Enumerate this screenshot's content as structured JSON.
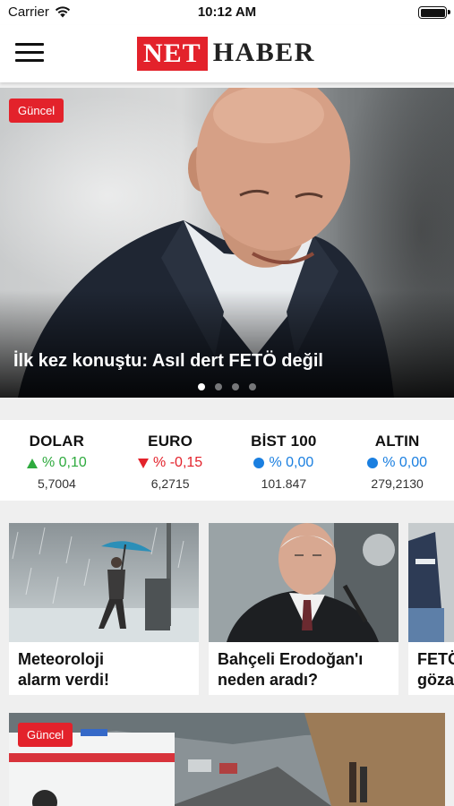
{
  "status_bar": {
    "carrier": "Carrier",
    "time": "10:12 AM"
  },
  "header": {
    "logo_red": "NET",
    "logo_dark": "HABER"
  },
  "hero": {
    "badge": "Güncel",
    "headline": "İlk kez konuştu: Asıl dert FETÖ değil",
    "slide_count": 4,
    "active_slide": 1
  },
  "markets": [
    {
      "name": "DOLAR",
      "change": "% 0,10",
      "direction": "up",
      "value": "5,7004",
      "color": "#2eaa3e"
    },
    {
      "name": "EURO",
      "change": "% -0,15",
      "direction": "down",
      "value": "6,2715",
      "color": "#e3222b"
    },
    {
      "name": "BİST 100",
      "change": "% 0,00",
      "direction": "flat",
      "value": "101.847",
      "color": "#1a7fe0"
    },
    {
      "name": "ALTIN",
      "change": "% 0,00",
      "direction": "flat",
      "value": "279,2130",
      "color": "#1a7fe0"
    }
  ],
  "cards": [
    {
      "title": "Meteoroloji\nalarm verdi!"
    },
    {
      "title": "Bahçeli Erodoğan'ı\nneden aradı?"
    },
    {
      "title": "FETÖ\ngöza"
    }
  ],
  "feature2": {
    "badge": "Güncel"
  },
  "colors": {
    "brand_red": "#e3222b",
    "up": "#2eaa3e",
    "down": "#e3222b",
    "neutral": "#1a7fe0"
  }
}
